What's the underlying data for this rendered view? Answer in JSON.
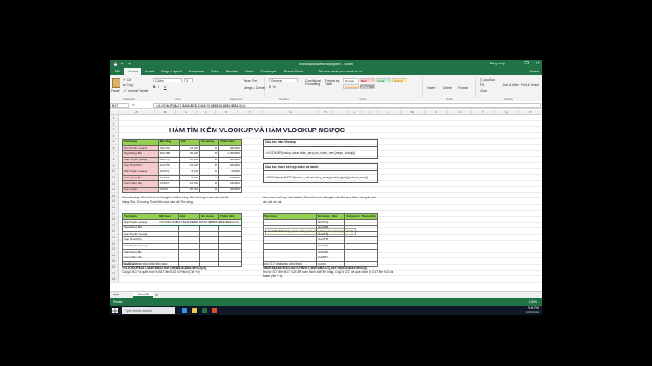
{
  "window": {
    "title": "Vlookup&indexkhopngược - Excel",
    "user": "Đăng nhập",
    "min": "—",
    "max": "❐",
    "close": "✕",
    "qat": [
      "💾",
      "↶",
      "↷"
    ]
  },
  "tabs": [
    "File",
    "Home",
    "Insert",
    "Page Layout",
    "Formulas",
    "Data",
    "Review",
    "View",
    "Developer",
    "Power Pivot"
  ],
  "tell_me": "Tell me what you want to do...",
  "share": "Share",
  "ribbon": {
    "clipboard": {
      "paste": "Paste",
      "cut": "✂ Cut",
      "copy": "⧉ Copy",
      "painter": "🖌 Format Painter",
      "label": "Clipboard"
    },
    "font": {
      "name": "Calibri",
      "size": "11",
      "bold": "B",
      "italic": "I",
      "underline": "U",
      "label": "Font"
    },
    "alignment": {
      "wrap": "Wrap Text",
      "merge": "Merge & Center",
      "label": "Alignment"
    },
    "number": {
      "format": "General",
      "symbols": "$ - % ,",
      "label": "Number"
    },
    "styles": {
      "cond": "Conditional Formatting",
      "table": "Format as Table",
      "label": "Styles",
      "cells": [
        "Normal",
        "Bad",
        "Good",
        "Neutral",
        "Calculation",
        "Check Cell"
      ]
    },
    "cells": {
      "insert": "Insert",
      "delete": "Delete",
      "format": "Format",
      "label": "Cells"
    },
    "editing": {
      "autosum": "∑ AutoSum",
      "fill": "Fill",
      "clear": "Clear",
      "sort": "Sort & Filter",
      "find": "Find & Select",
      "label": "Editing"
    }
  },
  "formula_bar": {
    "name_box": "B17",
    "fx": "fx",
    "formula": "=VLOOKUP($A17,$A$5:$E$12,MATCH($B$16,$B$4:$E$4,0),0)"
  },
  "columns": [
    "A",
    "B",
    "C",
    "D",
    "E",
    "F",
    "G",
    "H",
    "I",
    "J",
    "K",
    "L",
    "M",
    "N",
    "O",
    "P",
    "Q",
    "R"
  ],
  "rows": [
    "1",
    "2",
    "3",
    "4",
    "5",
    "6",
    "7",
    "8",
    "9",
    "10",
    "11",
    "12",
    "13",
    "14",
    "15",
    "16",
    "17",
    "18",
    "19",
    "20",
    "21",
    "22",
    "23",
    "24",
    "25",
    "26",
    "27",
    "28"
  ],
  "sheet_title": "HÀM TÌM KIẾM VLOOKUP VÀ HÀM VLOOKUP NGƯỢC",
  "table1": {
    "headers": [
      "Tên hàng",
      "Mã hàng",
      "Giá",
      "Số lượng",
      "Thành tiền"
    ],
    "rows": [
      [
        "Ngô Tuyền Quang",
        "NGOTQ",
        "24,000",
        "20",
        "480,000"
      ],
      [
        "Ngô Đông Bắc",
        "NGODB",
        "30,000",
        "45",
        "1,350,000"
      ],
      [
        "Gạo Tuyền Quang",
        "GAOTQ",
        "18,000",
        "25",
        "468,000"
      ],
      [
        "Gạo Thái Bình",
        "GAOTB",
        "16,000",
        "52",
        "832,000"
      ],
      [
        "Sắn Tuyền Quang",
        "SANTQ",
        "6,000",
        "11",
        "66,000"
      ],
      [
        "Sắn Đông Bắc",
        "SANDB",
        "5,000",
        "21",
        "105,000"
      ],
      [
        "Cam Hàm Yên",
        "CAMHY",
        "16,000",
        "15",
        "240,000"
      ],
      [
        "Cam canh",
        "CAMC",
        "20,000",
        "21",
        "420,000"
      ]
    ]
  },
  "box_vlookup": {
    "title": "Cấu trúc hàm Vlookup",
    "formula": "=VLOOKUP(lookup_value,table_array,col_index_num,[range_lookup])"
  },
  "box_index": {
    "title": "Cấu trúc Index kết hợp Index và Match",
    "formula": "=INDEX(array,MATCH(lookup_value,lookup_array,[match_type]),[column_num])"
  },
  "note_vlookup": "Hàm Vlookup: Cho biết trước thông tin cột thứ hàng. Điền thông tin vào các cột Mã hàng, Giá, Số lượng, Thành tiền dựa vào cột Tên hàng.",
  "note_index": "Hàm Index kết hợp hàm Match: Cho biết trước thông tin cột Mã hàng. Điền thông tin vào các cột còn lại.",
  "table2": {
    "headers": [
      "Tên hàng",
      "Mã hàng",
      "Giá",
      "Số lượng",
      "Thành tiền"
    ],
    "formula_cell": "=VLOOKUP($A17,$A$5:$E$12,MATCH($B$16,$B$4:$E$4,0),0)",
    "names": [
      "Ngô Tuyền Quang",
      "Ngô Đông Bắc",
      "Gạo Tuyền Quang",
      "Gạo Thái Bình",
      "Sắn Tuyền Quang",
      "Sắn Đông Bắc",
      "Cam Hàm Yên",
      "Cam canh"
    ]
  },
  "tooltip": "VLOOKUP(lookup_value, table_array, col_index_num, [range_lookup])",
  "table3": {
    "headers": [
      "Tên hàng",
      "Mã hàng",
      "Giá",
      "Số lượng",
      "Thành tiền"
    ],
    "codes": [
      "NGOTQ",
      "NGODB",
      "GAOTQ",
      "GAOTB",
      "SANTQ",
      "SANDB",
      "CAMHY",
      "CAMC"
    ]
  },
  "bottom_left": {
    "line1": "Tại ô B17 nhập vào công thức sau:",
    "line2": "=VLOOKUP($A17,$A$5:$E$12,MATCH($B$16,$B$4:$E$4,0),0)",
    "line3": "Copy ô B17 và quét chọn từ B17 đến E24 rồi Paste (Ctrl + v)"
  },
  "bottom_right": {
    "line1": "Tại ô G17 nhập vào công thức:",
    "line2": "=INDEX($A$5:$E$12,MATCH($H17,$B$5:$B$12,0),MATCH(I$16,$A$4:$E$4,0))",
    "line3": "Kéo từ G17 đến M17, G24 để hoàn thành cột Tên hàng. Copy ô G17 và quét chọn từ G17 đến K24 rồi Paste (Ctrl + v)"
  },
  "sheet_tab": "Sheet1",
  "sheet_add": "⊕",
  "status": {
    "ready": "Ready",
    "zoom": "100%"
  },
  "taskbar": {
    "search": "Type here to search",
    "time": "9:48 PM",
    "date": "5/28/2019"
  },
  "colors": {
    "excel_green": "#217346",
    "header_green": "#92d050",
    "pink": "#f6caca"
  }
}
